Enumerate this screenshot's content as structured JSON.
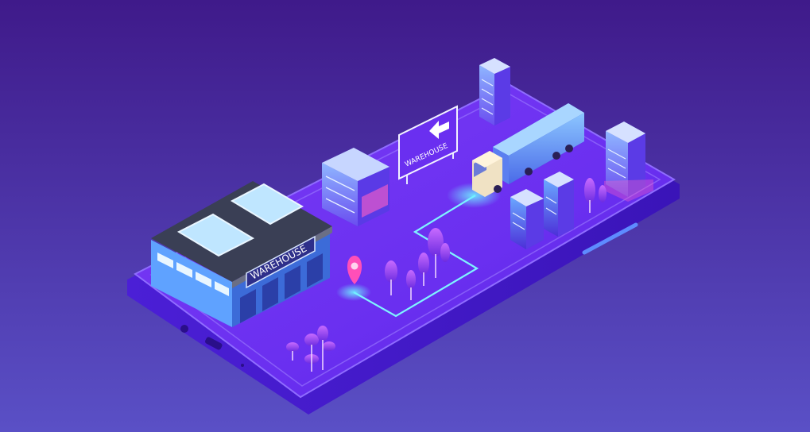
{
  "warehouse_sign": {
    "label": "WAREHOUSE"
  },
  "road_sign": {
    "label": "WAREHOUSE",
    "arrow_icon": "left-arrow-icon"
  },
  "colors": {
    "bg_top": "#3f1c8c",
    "bg_bottom": "#5b4fc4",
    "phone_top": "#6a2ff0",
    "phone_side": "#4a1bd0",
    "route": "#7ff3ff",
    "pin": "#ff4fb8",
    "glow": "#48e0ff"
  }
}
